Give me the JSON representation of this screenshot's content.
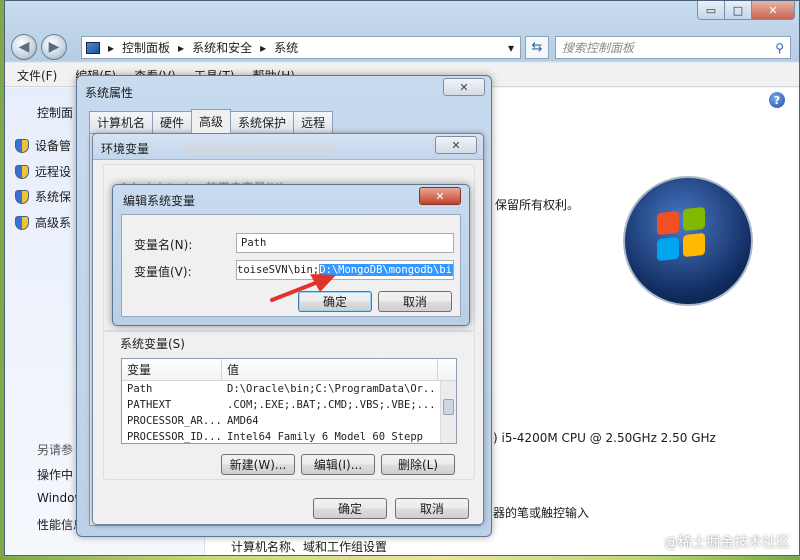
{
  "explorer": {
    "caption_buttons": {
      "minimize": "▭",
      "maximize": "□",
      "close": "✕"
    },
    "address": {
      "root_glyph": "▸",
      "crumbs": [
        "控制面板",
        "系统和安全",
        "系统"
      ],
      "separator": "▸",
      "dropdown_glyph": "▾"
    },
    "search_placeholder": "搜索控制面板",
    "menu": [
      "文件(F)",
      "编辑(E)",
      "查看(V)",
      "工具(T)",
      "帮助(H)"
    ],
    "left_pane": {
      "home": "控制面",
      "items": [
        "设备管",
        "远程设",
        "系统保",
        "高级系"
      ],
      "see_also": "另请参",
      "bottom_items": [
        "操作中",
        "Window",
        "性能信息"
      ]
    },
    "right_pane": {
      "copyright": "保留所有权利。",
      "cpu": ") i5-4200M CPU @ 2.50GHz   2.50 GHz",
      "pen": "器的笔或触控输入",
      "footer": "计算机名称、域和工作组设置"
    }
  },
  "system_properties": {
    "title": "系统属性",
    "close_label": "✕",
    "tabs": [
      "计算机名",
      "硬件",
      "高级",
      "系统保护",
      "远程"
    ],
    "active_tab": 2
  },
  "env_vars": {
    "title": "环境变量",
    "close_label": "✕",
    "user_vars_label": "Administrator 的用户变量(U)",
    "system_vars_label": "系统变量(S)",
    "columns": [
      "变量",
      "值"
    ],
    "rows": [
      {
        "name": "Path",
        "value": "D:\\Oracle\\bin;C:\\ProgramData\\Or..."
      },
      {
        "name": "PATHEXT",
        "value": ".COM;.EXE;.BAT;.CMD;.VBS;.VBE;...."
      },
      {
        "name": "PROCESSOR_AR...",
        "value": "AMD64"
      },
      {
        "name": "PROCESSOR_ID...",
        "value": "Intel64 Family 6 Model 60 Stepp"
      }
    ],
    "buttons": {
      "new": "新建(W)...",
      "edit": "编辑(I)...",
      "delete": "删除(L)"
    },
    "ok": "确定",
    "cancel": "取消"
  },
  "edit_var": {
    "title": "编辑系统变量",
    "close_label": "✕",
    "name_label": "变量名(N):",
    "name_value": "Path",
    "value_label": "变量值(V):",
    "value_prefix": "toiseSVN\\bin;",
    "value_selected": "D:\\MongoDB\\mongodb\\bin",
    "ok": "确定",
    "cancel": "取消"
  },
  "watermark": "@稀土掘金技术社区",
  "colors": {
    "arrow": "#e0332a",
    "selection": "#3399ff",
    "accent": "#2c61a6"
  }
}
